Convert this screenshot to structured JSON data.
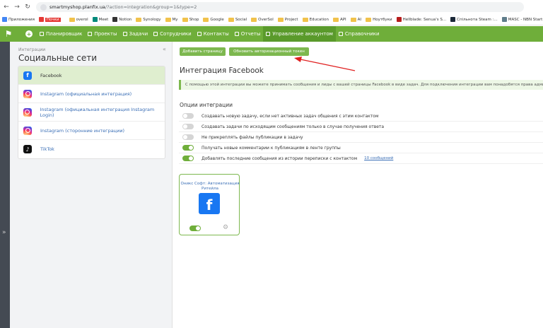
{
  "browser": {
    "url_host": "smartmyshop.planfix.ua",
    "url_path": "/?action=integration&group=1&type=2"
  },
  "bookmarks": [
    {
      "label": "Приложения",
      "icon": "apps-icon",
      "color": "#4285f4"
    },
    {
      "label": "Почки",
      "icon": "bookmark-icon",
      "color": "#e53935",
      "highlight": true
    },
    {
      "label": "",
      "icon": "separator"
    },
    {
      "label": "overol",
      "icon": "folder-icon"
    },
    {
      "label": "Meet",
      "icon": "meet-icon",
      "color": "#00897b"
    },
    {
      "label": "Notion",
      "icon": "notion-icon",
      "color": "#333333"
    },
    {
      "label": "Synology",
      "icon": "folder-icon"
    },
    {
      "label": "My",
      "icon": "folder-icon"
    },
    {
      "label": "Shop",
      "icon": "folder-icon"
    },
    {
      "label": "Google",
      "icon": "folder-icon"
    },
    {
      "label": "Social",
      "icon": "folder-icon"
    },
    {
      "label": "OverSol",
      "icon": "folder-icon"
    },
    {
      "label": "Project",
      "icon": "folder-icon"
    },
    {
      "label": "Education",
      "icon": "folder-icon"
    },
    {
      "label": "API",
      "icon": "folder-icon"
    },
    {
      "label": "AI",
      "icon": "folder-icon"
    },
    {
      "label": "Ноутбуки",
      "icon": "folder-icon"
    },
    {
      "label": "Hellblade: Senua's S...",
      "icon": "game-icon",
      "color": "#b71c1c"
    },
    {
      "label": "Спільнота Steam :...",
      "icon": "steam-icon",
      "color": "#1b2838"
    },
    {
      "label": "MASC - NBN Start",
      "icon": "site-icon",
      "color": "#607d8b"
    }
  ],
  "nav": {
    "items": [
      {
        "label": "Планировщик",
        "active": false
      },
      {
        "label": "Проекты",
        "active": false
      },
      {
        "label": "Задачи",
        "active": false
      },
      {
        "label": "Сотрудники",
        "active": false
      },
      {
        "label": "Контакты",
        "active": false
      },
      {
        "label": "Отчеты",
        "active": false
      },
      {
        "label": "Управление аккаунтом",
        "active": true
      },
      {
        "label": "Справочники",
        "active": false
      }
    ]
  },
  "sidebar": {
    "breadcrumb": "Интеграции",
    "title": "Социальные сети",
    "collapse_glyph": "«",
    "expand_glyph": "»",
    "items": [
      {
        "label": "Facebook",
        "icon": "facebook-icon",
        "active": true
      },
      {
        "label": "Instagram (официальная интеграция)",
        "icon": "instagram-icon",
        "active": false
      },
      {
        "label": "Instagram (официальная интеграция Instagram Login)",
        "icon": "instagram-icon",
        "active": false
      },
      {
        "label": "Instagram (сторонние интеграции)",
        "icon": "instagram-icon",
        "active": false
      },
      {
        "label": "TikTok",
        "icon": "tiktok-icon",
        "active": false
      }
    ]
  },
  "main": {
    "add_page_button": "Добавить страницу",
    "refresh_token_button": "Обновить авторизационный токен",
    "title": "Интеграция Facebook",
    "info": "С помощью этой интеграции вы можете принимать сообщения и лиды с вашей страницы Facebook в виде задач. Для подключения интеграции вам понадобятся права админи",
    "options_title": "Опции интеграции",
    "options": [
      {
        "label": "Создавать новую задачу, если нет активных задач общения с этим контактом",
        "on": false
      },
      {
        "label": "Создавать задачи по исходящим сообщениям только в случае получения ответа",
        "on": false
      },
      {
        "label": "Не прикреплять файлы публикации в задачу",
        "on": false
      },
      {
        "label": "Получать новые комментарии к публикациям в ленте группы",
        "on": true
      },
      {
        "label": "Добавлять последние сообщения из истории переписки с контактом",
        "on": true,
        "link": "10 сообщений"
      }
    ],
    "page_card": {
      "name": "Оникс Софт: Автоматизация Ритейла",
      "enabled": true
    }
  },
  "colors": {
    "brand_green": "#6fae3a",
    "button_green": "#7db84f",
    "link_blue": "#3b6fb6",
    "annotation_red": "#e02020"
  }
}
